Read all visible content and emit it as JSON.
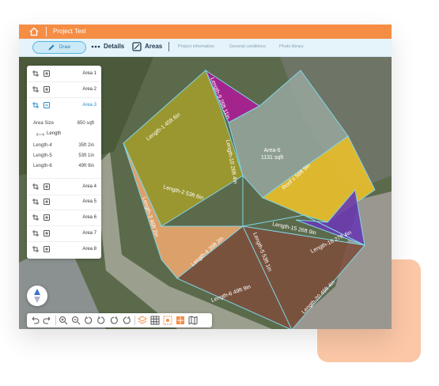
{
  "titlebar": {
    "title": "Project Test"
  },
  "toolbar": {
    "draw_label": "Draw",
    "details_label": "Details",
    "areas_label": "Areas",
    "links": [
      "Project information",
      "General conditions",
      "Photo library"
    ]
  },
  "panel": {
    "areas": [
      "Area 1",
      "Area 2",
      "Area 3",
      "Area 4",
      "Area 5",
      "Area 6",
      "Area 7",
      "Area 8"
    ],
    "active_area": "Area 3",
    "details": {
      "area_size_label": "Area Size",
      "area_size_value": "850 sqft",
      "length_header": "Length",
      "rows": [
        {
          "label": "Length-4",
          "value": "35ft 2in"
        },
        {
          "label": "Length-5",
          "value": "53ft 1in"
        },
        {
          "label": "Length-6",
          "value": "49ft 9in"
        }
      ]
    }
  },
  "map": {
    "labels": {
      "l1": "Length-1 45ft 6in",
      "l9": "Length-9 26ft 11in",
      "area6": "Area-6",
      "area6_size": "1131 sqft",
      "roof": "Roof c 56ft 9in",
      "l10": "Length-10 26ft 4in",
      "l2": "Length-2 53ft 6in",
      "l3": "Length-3 46ft 2in",
      "l4": "Length-4 35ft 2in",
      "l15": "Length-15 26ft 9in",
      "l16": "Length-16 27ft 4in",
      "l5": "Length-5 53ft 1in",
      "l6": "Length-6 49ft 9in",
      "l20": "Length-20 45ft 4in"
    }
  },
  "colors": {
    "accent": "#f58d45",
    "toolbar_bg": "#e5f4fb",
    "active_blue": "#2a8fd0",
    "poly_olive": "#a59f2c",
    "poly_magenta": "#b0189a",
    "poly_gray": "#95a49a",
    "poly_yellow": "#efc12a",
    "poly_orange": "#f2aa71",
    "poly_brown": "#7d4f3c",
    "poly_purple": "#6a3ab0"
  }
}
